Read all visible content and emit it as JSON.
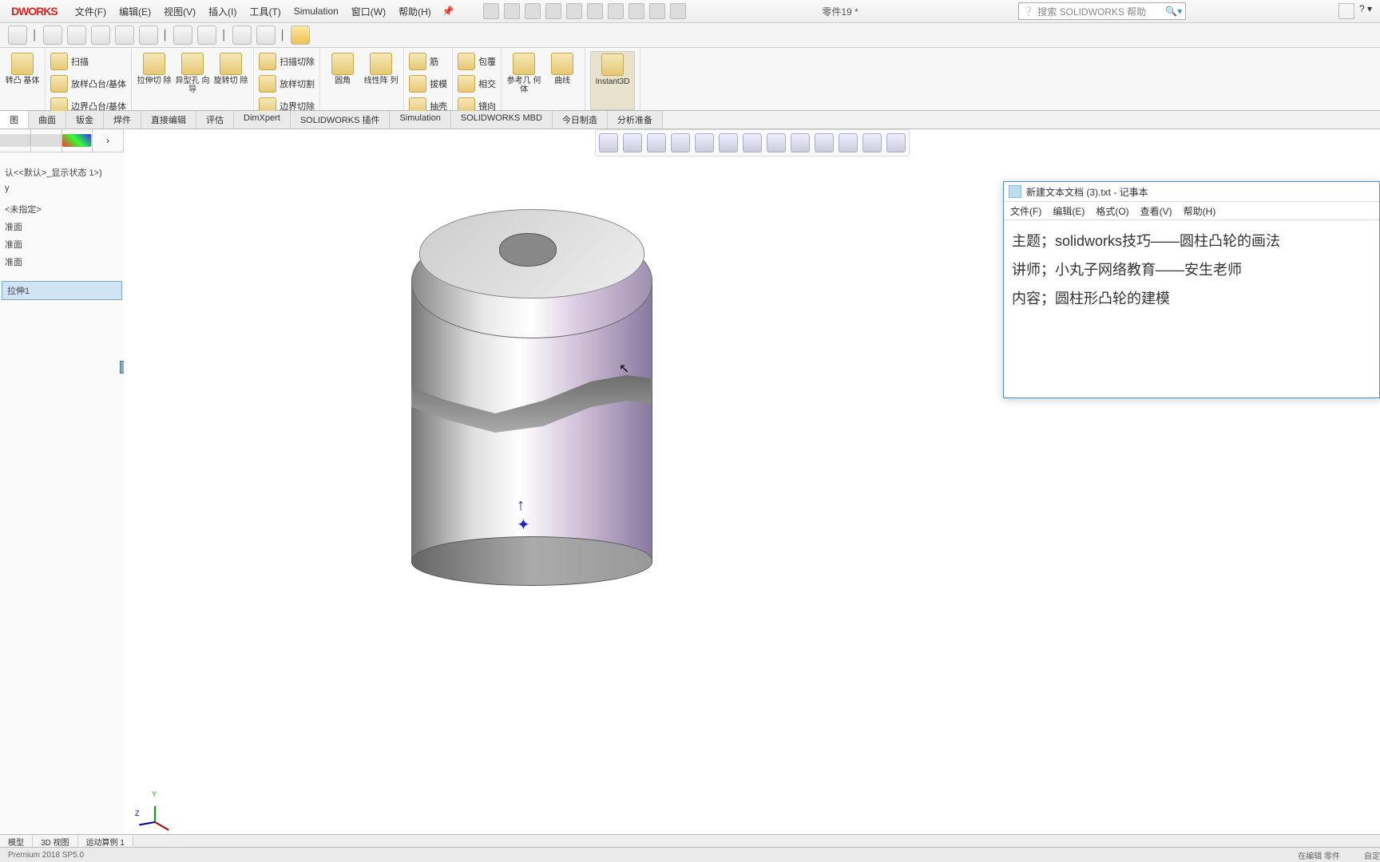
{
  "app": {
    "logo": "DWORKS",
    "docname": "零件19 *",
    "search_placeholder": "搜索 SOLIDWORKS 帮助"
  },
  "menu": [
    "文件(F)",
    "编辑(E)",
    "视图(V)",
    "插入(I)",
    "工具(T)",
    "Simulation",
    "窗口(W)",
    "帮助(H)"
  ],
  "ribbon": {
    "g0": [
      {
        "label": "转凸\n基体"
      }
    ],
    "g1": [
      {
        "label": "扫描"
      },
      {
        "label": "放样凸台/基体"
      },
      {
        "label": "边界凸台/基体"
      }
    ],
    "g2": [
      {
        "label": "拉伸切\n除"
      },
      {
        "label": "异型孔\n向导"
      },
      {
        "label": "旋转切\n除"
      }
    ],
    "g3": [
      {
        "label": "扫描切除"
      },
      {
        "label": "放样切割"
      },
      {
        "label": "边界切除"
      }
    ],
    "g4": [
      {
        "label": "圆角"
      },
      {
        "label": "线性阵\n列"
      }
    ],
    "g5": [
      {
        "label": "筋"
      },
      {
        "label": "拔模"
      },
      {
        "label": "抽壳"
      }
    ],
    "g6": [
      {
        "label": "包覆"
      },
      {
        "label": "相交"
      },
      {
        "label": "镜向"
      }
    ],
    "g7": [
      {
        "label": "参考几\n何体"
      },
      {
        "label": "曲线"
      }
    ],
    "g8": [
      {
        "label": "Instant3D"
      }
    ]
  },
  "tabs": [
    "图",
    "曲面",
    "钣金",
    "焊件",
    "直接编辑",
    "评估",
    "DimXpert",
    "SOLIDWORKS 插件",
    "Simulation",
    "SOLIDWORKS MBD",
    "今日制造",
    "分析准备"
  ],
  "tree": {
    "state": "认<<默认>_显示状态 1>)",
    "items": [
      "y",
      "",
      "<未指定>",
      "准面",
      "准面",
      "准面",
      "",
      "",
      "拉伸1"
    ]
  },
  "notepad": {
    "title": "新建文本文档 (3).txt - 记事本",
    "menu": [
      "文件(F)",
      "编辑(E)",
      "格式(O)",
      "查看(V)",
      "帮助(H)"
    ],
    "line1": "主题；solidworks技巧——圆柱凸轮的画法",
    "line2": "讲师；小丸子网络教育——安生老师",
    "line3": "内容；圆柱形凸轮的建模"
  },
  "bottomtabs": [
    "模型",
    "3D 视图",
    "运动算例 1"
  ],
  "status": {
    "left": "Premium 2018 SP5.0",
    "r1": "在编辑 零件",
    "r2": "自定义"
  }
}
